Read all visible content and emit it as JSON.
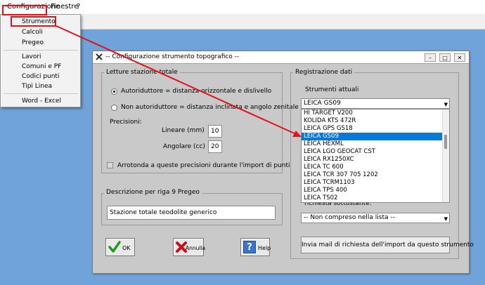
{
  "menubar": {
    "items": [
      "Configurazione",
      "Finestre",
      "?"
    ]
  },
  "menu": {
    "items": [
      "Strumento",
      "Calcoli",
      "Pregeo",
      "Lavori",
      "Comuni e PF",
      "Codici punti",
      "Tipi Linea",
      "Word - Excel"
    ]
  },
  "dialog": {
    "title": "-- Configurazione strumento topografico --",
    "letture": {
      "legend": "Letture stazione totale",
      "radio_auto": "Autoriduttore = distanza orizzontale e dislivello",
      "radio_non_auto": "Non autoriduttore = distanza inclinata e angolo zenitale",
      "precisioni_label": "Precisioni:",
      "lineare_label": "Lineare (mm)",
      "lineare_value": "10",
      "angolare_label": "Angolare (cc)",
      "angolare_value": "20",
      "arrotonda_label": "Arrotonda a queste precisioni durante l'import di punti"
    },
    "descrizione": {
      "legend": "Descrizione per riga 9 Pregeo",
      "value": "Stazione totale teodolite generico"
    },
    "buttons": {
      "ok": "OK",
      "annulla": "Annulla",
      "help": "Help"
    },
    "registrazione": {
      "legend": "Registrazione dati",
      "strumenti_label": "Strumenti attuali",
      "strumenti_selected": "LEICA GS09",
      "list_items": [
        "HI TARGET V200",
        "KOLIDA KTS 472R",
        "LEICA GPS GS18",
        "LEICA GS09",
        "LEICA HEXML",
        "LEICA LGO GEOCAT CST",
        "LEICA RX1250XC",
        "LEICA TC 600",
        "LEICA TCR 307 705 1202",
        "LEICA TCRM1103",
        "LEICA TPS 400",
        "LEICA TS02"
      ],
      "list_selected_index": 3,
      "richiesta_label": "richiesta sottostante.",
      "non_compreso": "-- Non compreso nella lista --",
      "invia_mail": "Invia mail di richiesta dell'import da questo strumento"
    }
  },
  "colors": {
    "accent_red": "#e0121b",
    "selection_blue": "#0a78d7",
    "desktop_blue": "#6fa3d9"
  }
}
